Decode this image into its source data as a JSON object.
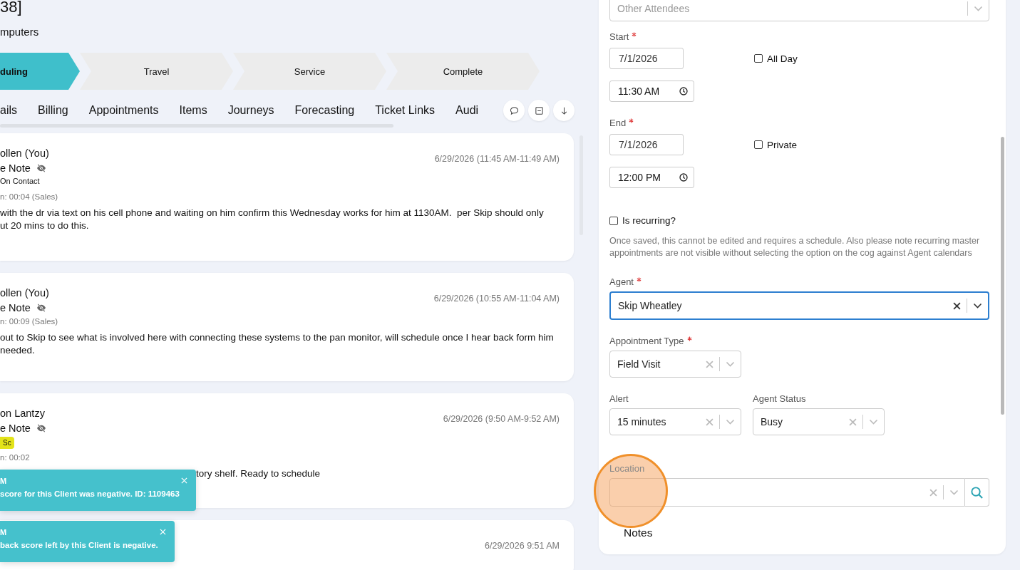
{
  "header": {
    "title": "38]",
    "subtitle": "mputers"
  },
  "stages": [
    {
      "label": "duling",
      "selected": true
    },
    {
      "label": "Travel",
      "selected": false
    },
    {
      "label": "Service",
      "selected": false
    },
    {
      "label": "Complete",
      "selected": false
    }
  ],
  "tabs": [
    {
      "label": "ails"
    },
    {
      "label": "Billing"
    },
    {
      "label": "Appointments"
    },
    {
      "label": "Items"
    },
    {
      "label": "Journeys"
    },
    {
      "label": "Forecasting"
    },
    {
      "label": "Ticket Links"
    },
    {
      "label": "Audi"
    }
  ],
  "notes": [
    {
      "author": "ollen (You)",
      "type": "e Note",
      "hidden": true,
      "contact": "On Contact",
      "duration": "n: 00:04 (Sales)",
      "body": "with the dr via text on his cell phone and waiting on him confirm this Wednesday works for him at 1130AM.  per Skip should only\nut 20 mins to do this.",
      "timestamp": "6/29/2026 (11:45 AM-11:49 AM)"
    },
    {
      "author": "ollen (You)",
      "type": "e Note",
      "hidden": true,
      "duration": "n: 00:09 (Sales)",
      "body": "out to Skip to see what is involved here with connecting these systems to the pan monitor, will schedule once I hear back form him\nneeded.",
      "timestamp": "6/29/2026 (10:55 AM-11:04 AM)"
    },
    {
      "author": "on Lantzy",
      "type": "e Note",
      "hidden": true,
      "tag": "Sc",
      "duration": "n: 00:02",
      "body": "tory shelf. Ready to schedule",
      "timestamp": "6/29/2026 (9:50 AM-9:52 AM)"
    },
    {
      "timestamp": "6/29/2026 9:51 AM"
    }
  ],
  "toasts": [
    {
      "title": "M",
      "message": "score for this Client was negative. ID: 1109463"
    },
    {
      "title": "M",
      "message": "back score left by this Client is negative."
    }
  ],
  "form": {
    "attendees": {
      "placeholder": "Other Attendees"
    },
    "start": {
      "label": "Start",
      "required": true,
      "date": "7/1/2026",
      "time": "11:30 AM"
    },
    "all_day": {
      "label": "All Day",
      "checked": false
    },
    "end": {
      "label": "End",
      "required": true,
      "date": "7/1/2026",
      "time": "12:00 PM"
    },
    "private": {
      "label": "Private",
      "checked": false
    },
    "recurring": {
      "label": "Is recurring?",
      "checked": false
    },
    "recurring_help": "Once saved, this cannot be edited and requires a schedule. Also please note recurring master appointments are not visible without selecting the option on the cog against Agent calendars",
    "agent": {
      "label": "Agent",
      "required": true,
      "value": "Skip Wheatley",
      "focused": true
    },
    "appointment_type": {
      "label": "Appointment Type",
      "required": true,
      "value": "Field Visit",
      "focused": false
    },
    "alert": {
      "label": "Alert",
      "value": "15 minutes",
      "focused": false
    },
    "agent_status": {
      "label": "Agent Status",
      "value": "Busy",
      "focused": false
    },
    "location": {
      "label": "Location",
      "focused": false
    },
    "notes_tab": {
      "label": "Notes"
    }
  }
}
